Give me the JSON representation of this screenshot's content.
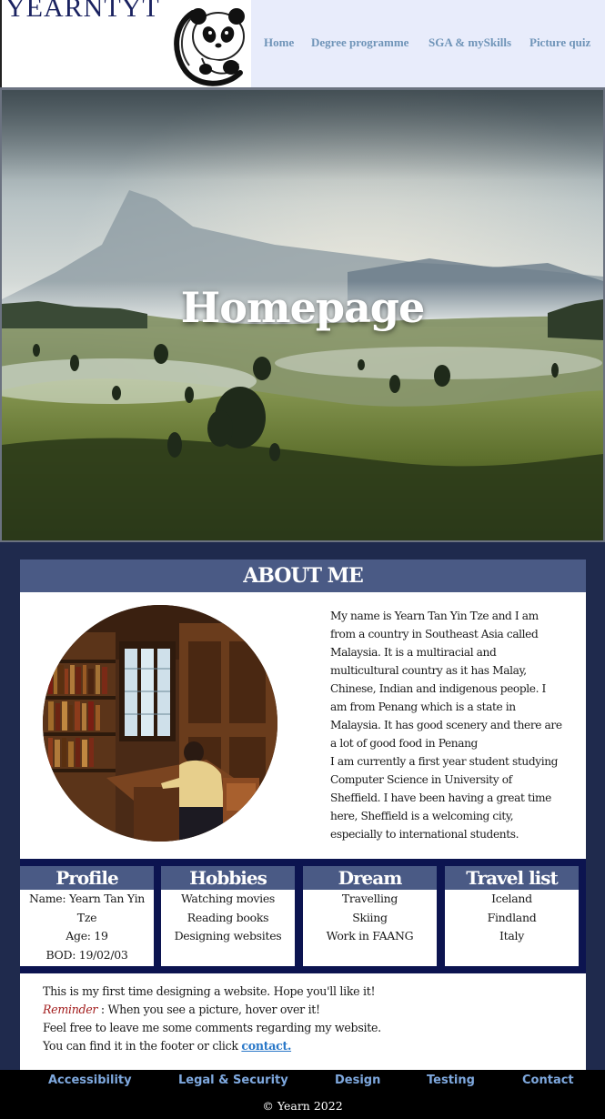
{
  "header": {
    "site_name": "YEARNTYT",
    "nav": [
      "Home",
      "Degree programme",
      "SGA & mySkills",
      "Picture quiz"
    ]
  },
  "hero": {
    "title": "Homepage"
  },
  "about": {
    "heading": "ABOUT ME",
    "paragraphs": [
      "My name is Yearn Tan Yin Tze and I am from a country in Southeast Asia called Malaysia. It is a multiracial and multicultural country as it has Malay, Chinese, Indian and indigenous people. I am from Penang which is a state in Malaysia. It has good scenery and there are a lot of good food in Penang",
      "I am currently a first year student studying Computer Science in University of Sheffield. I have been having a great time here, Sheffield is a welcoming city, especially to international students."
    ]
  },
  "cards": [
    {
      "title": "Profile",
      "lines": [
        "Name: Yearn Tan Yin Tze",
        "Age: 19",
        "BOD: 19/02/03"
      ]
    },
    {
      "title": "Hobbies",
      "lines": [
        "Watching movies",
        "Reading books",
        "Designing websites"
      ]
    },
    {
      "title": "Dream",
      "lines": [
        "Travelling",
        "Skiing",
        "Work in FAANG"
      ]
    },
    {
      "title": "Travel list",
      "lines": [
        "Iceland",
        "Findland",
        "Italy"
      ]
    }
  ],
  "notes": {
    "line1": "This is my first time designing a website. Hope you'll like it!",
    "reminder_label": "Reminder",
    "reminder_text": " : When you see a picture, hover over it!",
    "line3": "Feel free to leave me some comments regarding my website.",
    "line4_prefix": "You can find it in the footer or click ",
    "contact_link": "contact."
  },
  "footer": {
    "links": [
      "Accessibility",
      "Legal & Security",
      "Design",
      "Testing",
      "Contact"
    ],
    "copyright": "© Yearn 2022"
  },
  "colors": {
    "nav_text": "#6f94b8",
    "section_bg": "#1f2a4d",
    "heading_bar": "#4a5a85",
    "cards_band": "#0c1450",
    "reminder": "#a21c1c",
    "link": "#2a78c8",
    "footer_link": "#7ea8de"
  },
  "icons": {
    "logo": "panda-logo-icon"
  }
}
